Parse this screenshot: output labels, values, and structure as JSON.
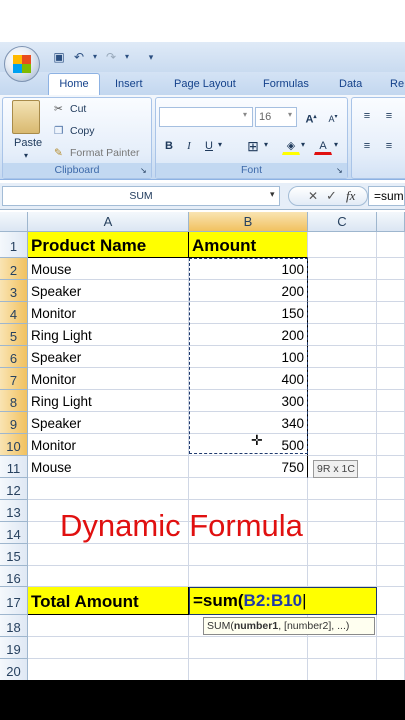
{
  "ribbon": {
    "tabs": [
      "Home",
      "Insert",
      "Page Layout",
      "Formulas",
      "Data",
      "Re"
    ],
    "clipboard": {
      "paste": "Paste",
      "cut": "Cut",
      "copy": "Copy",
      "format_painter": "Format Painter",
      "label": "Clipboard"
    },
    "font": {
      "size": "16",
      "label": "Font"
    },
    "icons": {
      "office": "office-logo-icon",
      "save": "save-icon",
      "undo": "undo-icon",
      "redo": "redo-icon",
      "bold": "bold-icon",
      "italic": "italic-icon",
      "underline": "underline-icon"
    }
  },
  "formula_bar": {
    "name_box": "SUM",
    "formula": "=sum"
  },
  "columns": [
    "A",
    "B",
    "C"
  ],
  "rows": [
    {
      "n": "1",
      "a": "Product Name",
      "b": "Amount"
    },
    {
      "n": "2",
      "a": "Mouse",
      "b": "100"
    },
    {
      "n": "3",
      "a": "Speaker",
      "b": "200"
    },
    {
      "n": "4",
      "a": "Monitor",
      "b": "150"
    },
    {
      "n": "5",
      "a": "Ring Light",
      "b": "200"
    },
    {
      "n": "6",
      "a": "Speaker",
      "b": "100"
    },
    {
      "n": "7",
      "a": "Monitor",
      "b": "400"
    },
    {
      "n": "8",
      "a": "Ring Light",
      "b": "300"
    },
    {
      "n": "9",
      "a": "Speaker",
      "b": "340"
    },
    {
      "n": "10",
      "a": "Monitor",
      "b": "500"
    },
    {
      "n": "11",
      "a": "Mouse",
      "b": "750"
    },
    {
      "n": "12",
      "a": "",
      "b": ""
    },
    {
      "n": "13",
      "a": "",
      "b": ""
    },
    {
      "n": "14",
      "a": "",
      "b": ""
    },
    {
      "n": "15",
      "a": "",
      "b": ""
    },
    {
      "n": "16",
      "a": "",
      "b": ""
    },
    {
      "n": "17",
      "a": "Total Amount",
      "b": ""
    },
    {
      "n": "18",
      "a": "",
      "b": ""
    },
    {
      "n": "19",
      "a": "",
      "b": ""
    },
    {
      "n": "20",
      "a": "",
      "b": ""
    }
  ],
  "overlay": {
    "title": "Dynamic Formula",
    "selection_tip": "9R x 1C",
    "edit_prefix": "=sum(",
    "edit_ref": "B2:B10",
    "fn_tip_name": "SUM(",
    "fn_tip_arg1": "number1",
    "fn_tip_rest": ", [number2], ...)"
  },
  "colors": {
    "highlight": "#ffff00",
    "title": "#e01010",
    "accent": "#15428b"
  }
}
